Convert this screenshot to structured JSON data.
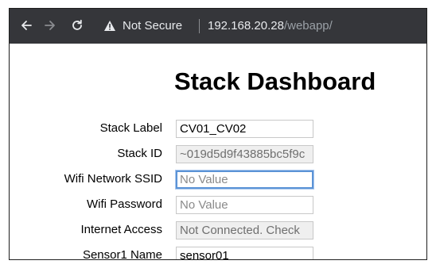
{
  "browser": {
    "security_label": "Not Secure",
    "url_host": "192.168.20.28",
    "url_path": "/webapp/",
    "icons": {
      "back": "back-arrow-icon",
      "forward": "forward-arrow-icon",
      "reload": "reload-icon",
      "security": "warning-triangle-icon"
    }
  },
  "page": {
    "title": "Stack Dashboard",
    "fields": [
      {
        "label": "Stack Label",
        "value": "CV01_CV02",
        "placeholder": ""
      },
      {
        "label": "Stack ID",
        "value": "~019d5d9f43885bc5f9c",
        "placeholder": ""
      },
      {
        "label": "Wifi Network SSID",
        "value": "",
        "placeholder": "No Value"
      },
      {
        "label": "Wifi Password",
        "value": "",
        "placeholder": "No Value"
      },
      {
        "label": "Internet Access",
        "value": "Not Connected. Check",
        "placeholder": ""
      },
      {
        "label": "Sensor1 Name",
        "value": "sensor01",
        "placeholder": ""
      }
    ]
  },
  "colors": {
    "toolbar_bg": "#35363a",
    "focus_ring": "#5b93d6",
    "readonly_bg": "#efefef"
  }
}
